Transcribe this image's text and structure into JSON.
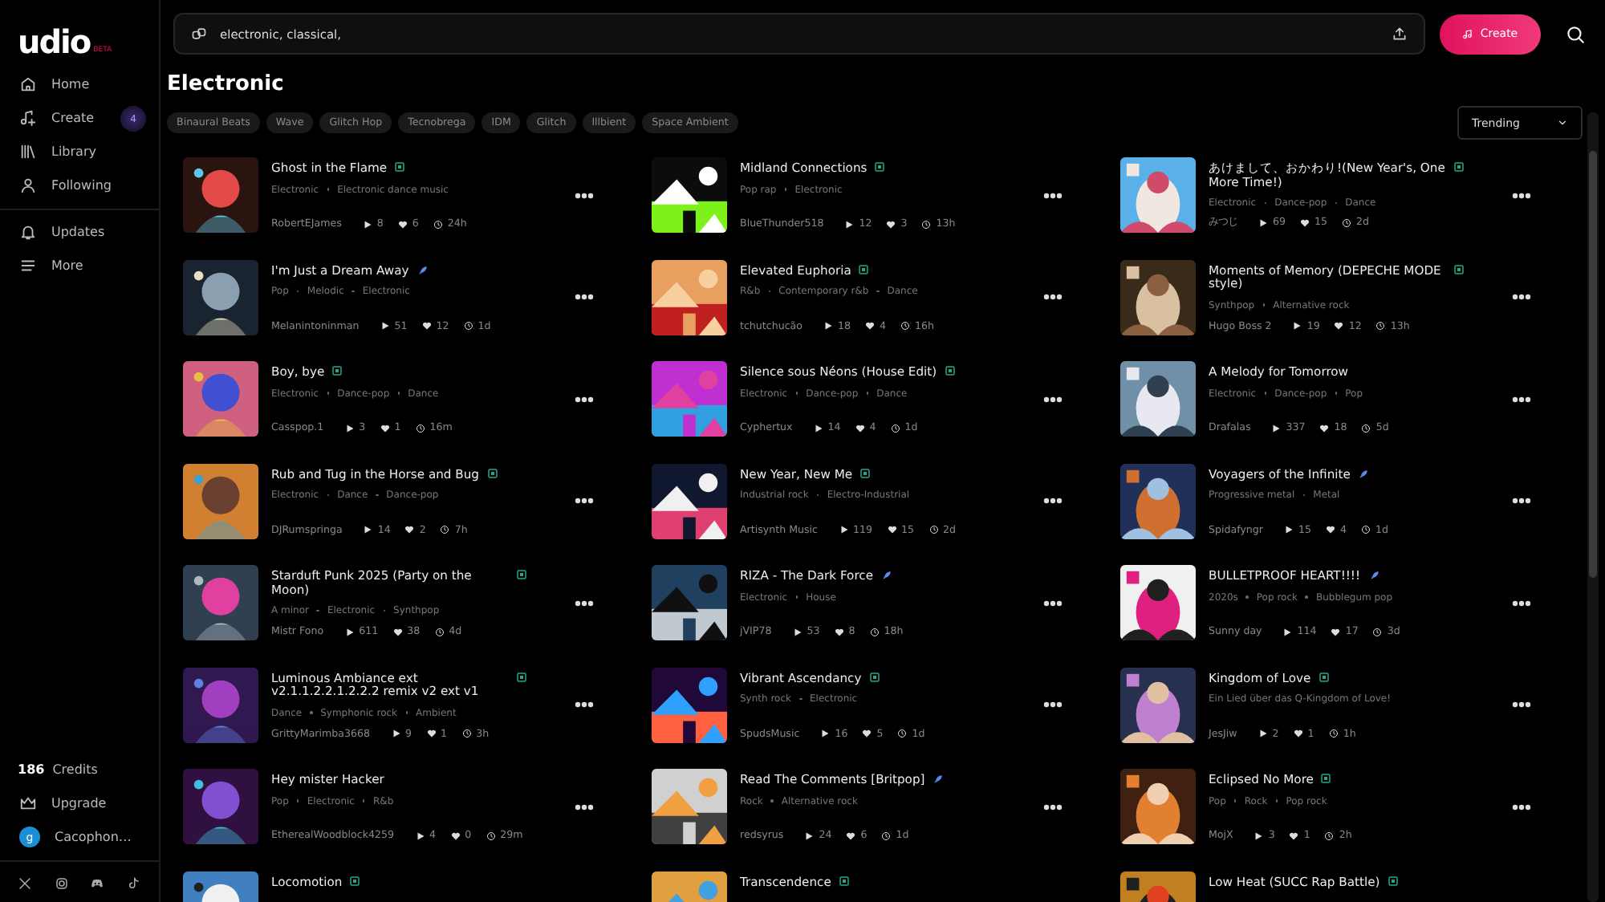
{
  "sidebar": {
    "logo": "udio",
    "logo_tag": "BETA",
    "items": [
      {
        "label": "Home",
        "selected": false
      },
      {
        "label": "Create",
        "badge": "4",
        "selected": false
      },
      {
        "label": "Library",
        "selected": false
      },
      {
        "label": "Following",
        "selected": false
      }
    ],
    "secondary_items": [
      {
        "label": "Updates"
      },
      {
        "label": "More"
      }
    ],
    "credits": {
      "count": "186",
      "label": "Credits"
    },
    "upgrade": "Upgrade",
    "user": {
      "initial": "g",
      "name": "Cacophon…"
    }
  },
  "search": {
    "value": "electronic, classical,"
  },
  "create_button": "Create",
  "heading": "Electronic",
  "tags": [
    "Binaural Beats",
    "Wave",
    "Glitch Hop",
    "Tecnobrega",
    "IDM",
    "Glitch",
    "Illbient",
    "Space Ambient"
  ],
  "sort": {
    "value": "Trending"
  },
  "songs": [
    {
      "title": "Ghost in the Flame",
      "kind": "box",
      "tags": [
        "Electronic",
        "Electronic dance music"
      ],
      "author": "RobertEJames",
      "plays": "8",
      "likes": "6",
      "age": "24h"
    },
    {
      "title": "Midland Connections",
      "kind": "box",
      "tags": [
        "Pop rap",
        "Electronic"
      ],
      "author": "BlueThunder518",
      "plays": "12",
      "likes": "3",
      "age": "13h"
    },
    {
      "title": "あけまして、おかわり!(New Year's, One More Time!)",
      "kind": "box",
      "tags": [
        "Electronic",
        "Dance-pop",
        "Dance"
      ],
      "author": "みつじ",
      "plays": "69",
      "likes": "15",
      "age": "2d"
    },
    {
      "title": "I'm Just a Dream Away",
      "kind": "rocket",
      "tags": [
        "Pop",
        "Melodic",
        "Electronic"
      ],
      "author": "Melanintoninman",
      "plays": "51",
      "likes": "12",
      "age": "1d"
    },
    {
      "title": "Elevated Euphoria",
      "kind": "box",
      "tags": [
        "R&b",
        "Contemporary r&b",
        "Dance"
      ],
      "author": "tchutchucão",
      "plays": "18",
      "likes": "4",
      "age": "16h"
    },
    {
      "title": "Moments of Memory (DEPECHE MODE style)",
      "kind": "box",
      "tags": [
        "Synthpop",
        "Alternative rock"
      ],
      "author": "Hugo Boss 2",
      "plays": "19",
      "likes": "12",
      "age": "13h"
    },
    {
      "title": "Boy, bye",
      "kind": "box",
      "tags": [
        "Electronic",
        "Dance-pop",
        "Dance"
      ],
      "author": "Casspop.1",
      "plays": "3",
      "likes": "1",
      "age": "16m"
    },
    {
      "title": "Silence sous Néons (House Edit)",
      "kind": "box",
      "tags": [
        "Electronic",
        "Dance-pop",
        "Dance"
      ],
      "author": "Cyphertux",
      "plays": "14",
      "likes": "4",
      "age": "1d"
    },
    {
      "title": "A Melody for Tomorrow",
      "kind": "plain",
      "tags": [
        "Electronic",
        "Dance-pop",
        "Pop"
      ],
      "author": "Drafalas",
      "plays": "337",
      "likes": "18",
      "age": "5d"
    },
    {
      "title": "Rub and Tug in the Horse and Bug",
      "kind": "box",
      "tags": [
        "Electronic",
        "Dance",
        "Dance-pop"
      ],
      "author": "DJRumspringa",
      "plays": "14",
      "likes": "2",
      "age": "7h"
    },
    {
      "title": "New Year, New Me",
      "kind": "box",
      "tags": [
        "Industrial rock",
        "Electro-Industrial"
      ],
      "author": "Artisynth Music",
      "plays": "119",
      "likes": "15",
      "age": "2d"
    },
    {
      "title": "Voyagers of the Infinite",
      "kind": "rocket",
      "tags": [
        "Progressive metal",
        "Metal"
      ],
      "author": "Spidafyngr",
      "plays": "15",
      "likes": "4",
      "age": "1d"
    },
    {
      "title": "Starduft Punk 2025 (Party on the Moon)",
      "kind": "box",
      "tags": [
        "A minor",
        "Electronic",
        "Synthpop"
      ],
      "author": "Mistr Fono",
      "plays": "611",
      "likes": "38",
      "age": "4d"
    },
    {
      "title": "RIZA - The Dark Force",
      "kind": "rocket",
      "tags": [
        "Electronic",
        "House"
      ],
      "author": "jVIP78",
      "plays": "53",
      "likes": "8",
      "age": "18h"
    },
    {
      "title": "BULLETPROOF HEART!!!!",
      "kind": "rocket",
      "tags": [
        "2020s",
        "Pop rock",
        "Bubblegum pop"
      ],
      "author": "Sunny day",
      "plays": "114",
      "likes": "17",
      "age": "3d"
    },
    {
      "title": "Luminous Ambiance ext v2.1.1.2.2.1.2.2.2 remix v2 ext v1",
      "kind": "box",
      "tags": [
        "Dance",
        "Symphonic rock",
        "Ambient"
      ],
      "author": "GrittyMarimba3668",
      "plays": "9",
      "likes": "1",
      "age": "3h"
    },
    {
      "title": "Vibrant Ascendancy",
      "kind": "box",
      "tags": [
        "Synth rock",
        "Electronic"
      ],
      "author": "SpudsMusic",
      "plays": "16",
      "likes": "5",
      "age": "1d"
    },
    {
      "title": "Kingdom of Love",
      "kind": "box",
      "tags": [
        "Ein Lied über das Q-Kingdom of Love!"
      ],
      "author": "JesJiw",
      "plays": "2",
      "likes": "1",
      "age": "1h"
    },
    {
      "title": "Hey mister Hacker",
      "kind": "plain",
      "tags": [
        "Pop",
        "Electronic",
        "R&b"
      ],
      "author": "EtherealWoodblock4259",
      "plays": "4",
      "likes": "0",
      "age": "29m"
    },
    {
      "title": "Read The Comments [Britpop]",
      "kind": "rocket",
      "tags": [
        "Rock",
        "Alternative rock"
      ],
      "author": "redsyrus",
      "plays": "24",
      "likes": "6",
      "age": "1d"
    },
    {
      "title": "Eclipsed No More",
      "kind": "box",
      "tags": [
        "Pop",
        "Rock",
        "Pop rock"
      ],
      "author": "MojX",
      "plays": "3",
      "likes": "1",
      "age": "2h"
    },
    {
      "title": "Locomotion",
      "kind": "box"
    },
    {
      "title": "Transcendence",
      "kind": "box"
    },
    {
      "title": "Low Heat (SUCC Rap Battle)",
      "kind": "box"
    }
  ]
}
